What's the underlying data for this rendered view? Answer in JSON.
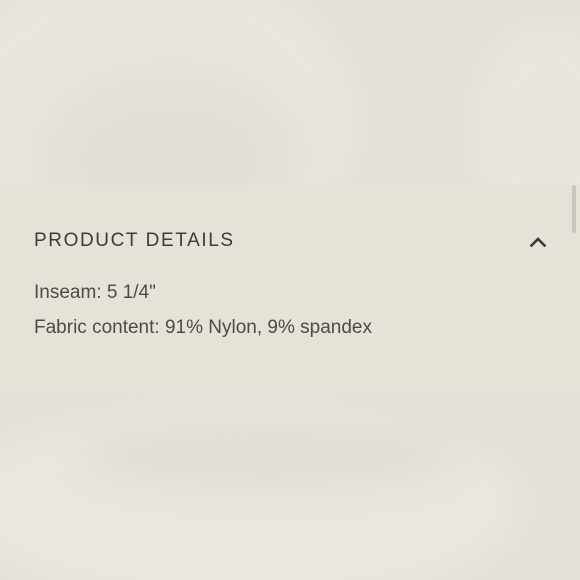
{
  "product_details": {
    "title": "PRODUCT DETAILS",
    "toggle_icon": "chevron-up-icon",
    "expanded": true,
    "items": [
      {
        "text": "Inseam: 5 1/4\""
      },
      {
        "text": "Fabric content: 91% Nylon, 9% spandex"
      }
    ]
  },
  "colors": {
    "background": "#e5e2da",
    "panel": "#e6e2d8",
    "title_text": "#3b3d3b",
    "body_text": "#4a4c4a"
  }
}
